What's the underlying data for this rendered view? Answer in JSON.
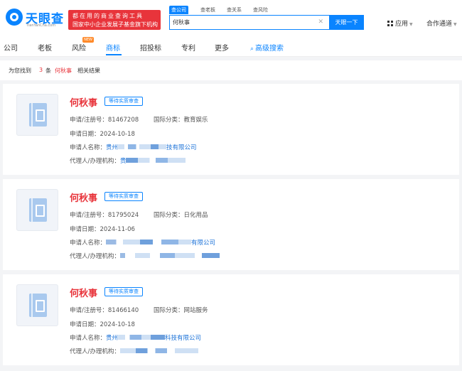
{
  "brand": {
    "name": "天眼查",
    "domain": "TianYanCha.com",
    "promo_line1": "都在用的商业查询工具",
    "promo_line2": "国家中小企业发展子基金旗下机构"
  },
  "search": {
    "tabs": [
      "查公司",
      "查老板",
      "查关系",
      "查风险"
    ],
    "active_tab": "查公司",
    "value": "何秋事",
    "button_label": "天眼一下"
  },
  "header_right": {
    "apps_label": "应用",
    "partner_label": "合作通道"
  },
  "nav": {
    "items": [
      "公司",
      "老板",
      "风险",
      "商标",
      "招投标",
      "专利",
      "更多"
    ],
    "active": "商标",
    "new_badge": "NEW",
    "advanced_label": "高级搜索"
  },
  "summary": {
    "prefix": "为您找到",
    "count": "3",
    "unit": "条",
    "keyword": "何秋事",
    "suffix": "相关结果"
  },
  "results": [
    {
      "name": "何秋事",
      "status": "等待实质审查",
      "reg_label": "申请/注册号：",
      "reg_no": "81467208",
      "class_label": "国际分类：",
      "class_value": "教育娱乐",
      "date_label": "申请日期：",
      "date": "2024-10-18",
      "applicant_label": "申请人名称：",
      "applicant_visible": "贵州",
      "applicant_suffix": "技有限公司",
      "agent_label": "代理人/办理机构：",
      "agent_visible": "贵"
    },
    {
      "name": "何秋事",
      "status": "等待实质审查",
      "reg_label": "申请/注册号：",
      "reg_no": "81795024",
      "class_label": "国际分类：",
      "class_value": "日化用品",
      "date_label": "申请日期：",
      "date": "2024-11-06",
      "applicant_label": "申请人名称：",
      "applicant_visible": "",
      "applicant_suffix": "有限公司",
      "agent_label": "代理人/办理机构：",
      "agent_visible": ""
    },
    {
      "name": "何秋事",
      "status": "等待实质审查",
      "reg_label": "申请/注册号：",
      "reg_no": "81466140",
      "class_label": "国际分类：",
      "class_value": "网站服务",
      "date_label": "申请日期：",
      "date": "2024-10-18",
      "applicant_label": "申请人名称：",
      "applicant_visible": "贵州",
      "applicant_suffix": "科技有限公司",
      "agent_label": "代理人/办理机构：",
      "agent_visible": ""
    }
  ],
  "colors": {
    "accent": "#0a84ff",
    "brand_red": "#e8343b",
    "link": "#1b72d8"
  }
}
